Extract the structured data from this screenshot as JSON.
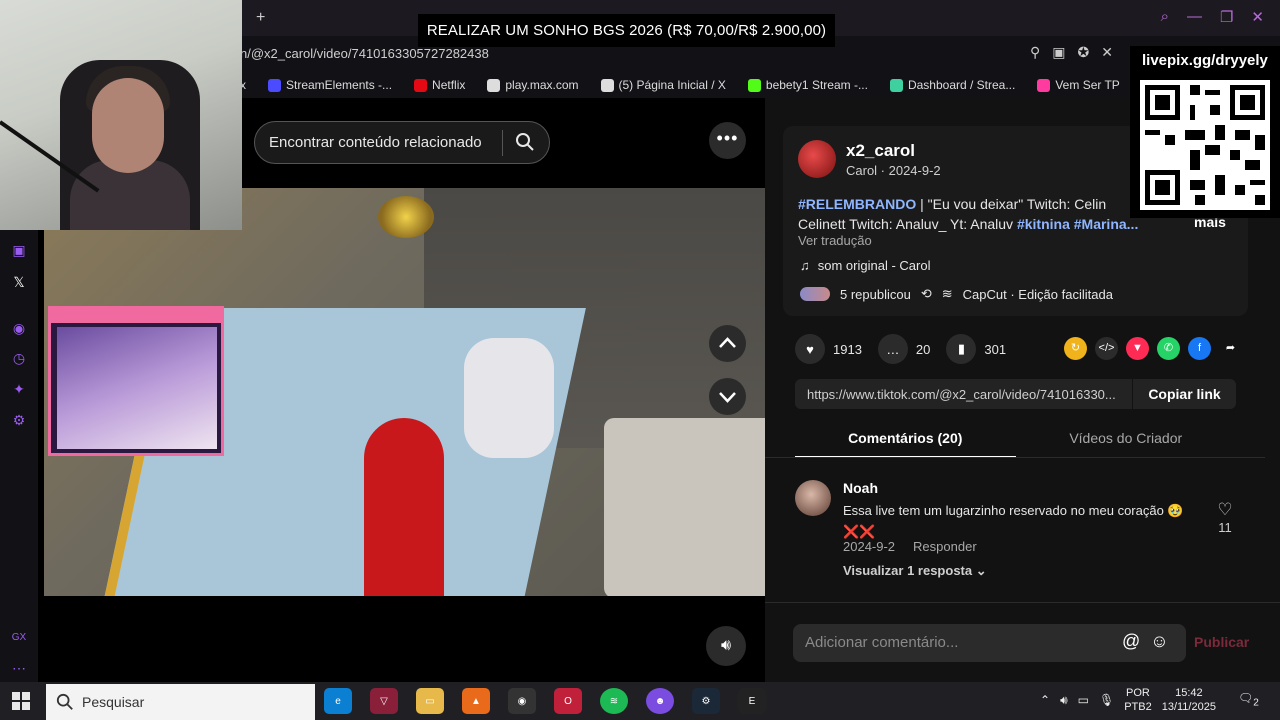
{
  "overlay": {
    "banner": "REALIZAR UM SONHO BGS 2026 (R$ 70,00/R$ 2.900,00)",
    "qr_label": "livepix.gg/dryyely"
  },
  "browser": {
    "url": "n/@x2_carol/video/7410163305727282438",
    "bookmarks": [
      {
        "label": "x",
        "color": "#ffffff"
      },
      {
        "label": "StreamElements -...",
        "color": "#4b4bff"
      },
      {
        "label": "Netflix",
        "color": "#e50914"
      },
      {
        "label": "play.max.com",
        "color": "#dddddd"
      },
      {
        "label": "(5) Página Inicial / X",
        "color": "#dddddd"
      },
      {
        "label": "bebety1 Stream -...",
        "color": "#53fc18"
      },
      {
        "label": "Dashboard / Strea...",
        "color": "#3fd0a0"
      },
      {
        "label": "Vem Ser TP",
        "color": "#ff3ba0"
      }
    ]
  },
  "video": {
    "search_placeholder": "Encontrar conteúdo relacionado",
    "more": "•••"
  },
  "post": {
    "username": "x2_carol",
    "subline": "Carol · 2024-9-2",
    "desc_tag1": "#RELEMBRANDO",
    "desc_text1": " | \"Eu vou deixar\" Twitch: Celin",
    "desc_text2": "Celinett Twitch: Analuv_ Yt: Analuv ",
    "desc_tag2": "#kitnina",
    "desc_tag3": " #Marina...",
    "more_label": "mais",
    "translate": "Ver tradução",
    "sound": "som original - Carol",
    "reposts": "5 republicou",
    "capcut": "CapCut · Edição facilitada",
    "likes": "1913",
    "comments": "20",
    "saves": "301",
    "link": "https://www.tiktok.com/@x2_carol/video/741016330...",
    "copy_link": "Copiar link",
    "tab_comments": "Comentários (20)",
    "tab_creator": "Vídeos do Criador"
  },
  "comment": {
    "name": "Noah",
    "text": "Essa live tem um lugarzinho reservado no meu coração 🥹 ❌❌",
    "date": "2024-9-2",
    "reply": "Responder",
    "likes": "11",
    "view_replies": "Visualizar 1 resposta ⌄"
  },
  "compose": {
    "placeholder": "Adicionar comentário...",
    "publish": "Publicar"
  },
  "taskbar": {
    "search": "Pesquisar",
    "lang1": "POR",
    "lang2": "PTB2",
    "time": "15:42",
    "date": "13/11/2025",
    "notif": "2"
  }
}
